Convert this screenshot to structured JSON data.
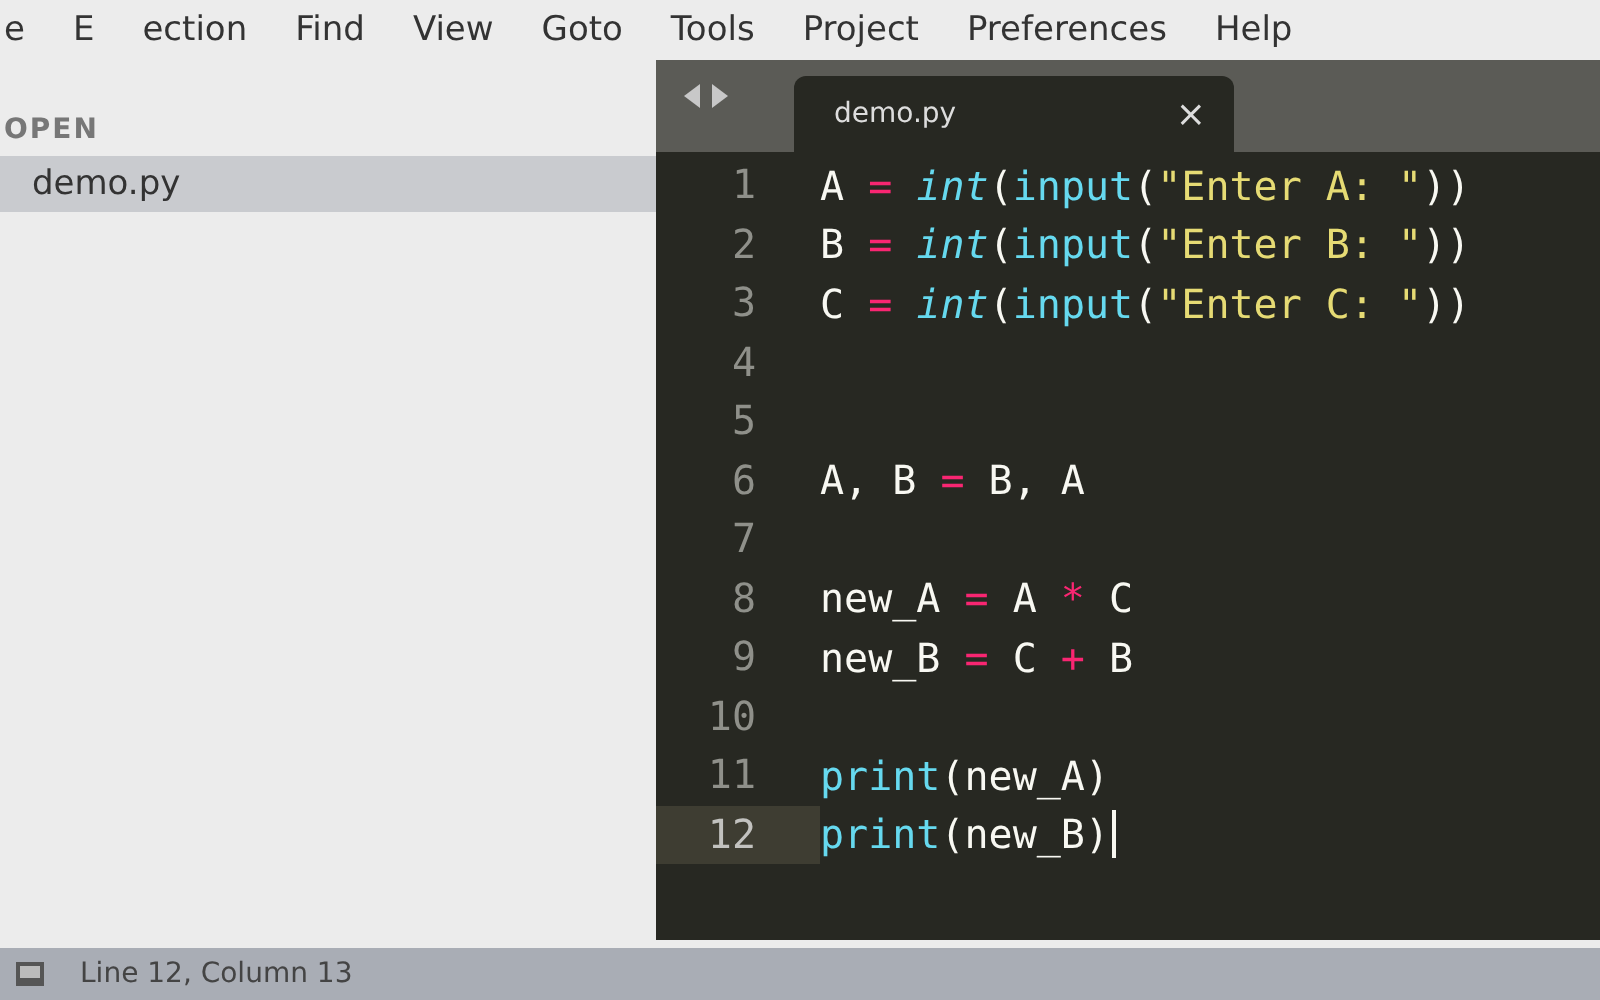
{
  "menu": [
    "e",
    "E",
    "ection",
    "Find",
    "View",
    "Goto",
    "Tools",
    "Project",
    "Preferences",
    "Help"
  ],
  "sidebar": {
    "header": "OPEN",
    "items": [
      {
        "label": "demo.py",
        "selected": true
      }
    ]
  },
  "tabs": [
    {
      "label": "demo.py",
      "selected": true,
      "close": "×"
    }
  ],
  "editor": {
    "lines": [
      {
        "number": "1",
        "current": false,
        "tokens": [
          {
            "kind": "plain",
            "text": "A "
          },
          {
            "kind": "op",
            "text": "= "
          },
          {
            "kind": "type",
            "text": "int"
          },
          {
            "kind": "plain",
            "text": "("
          },
          {
            "kind": "func",
            "text": "input"
          },
          {
            "kind": "plain",
            "text": "("
          },
          {
            "kind": "string",
            "text": "\"Enter A: \""
          },
          {
            "kind": "plain",
            "text": "))"
          }
        ]
      },
      {
        "number": "2",
        "current": false,
        "tokens": [
          {
            "kind": "plain",
            "text": "B "
          },
          {
            "kind": "op",
            "text": "= "
          },
          {
            "kind": "type",
            "text": "int"
          },
          {
            "kind": "plain",
            "text": "("
          },
          {
            "kind": "func",
            "text": "input"
          },
          {
            "kind": "plain",
            "text": "("
          },
          {
            "kind": "string",
            "text": "\"Enter B: \""
          },
          {
            "kind": "plain",
            "text": "))"
          }
        ]
      },
      {
        "number": "3",
        "current": false,
        "tokens": [
          {
            "kind": "plain",
            "text": "C "
          },
          {
            "kind": "op",
            "text": "= "
          },
          {
            "kind": "type",
            "text": "int"
          },
          {
            "kind": "plain",
            "text": "("
          },
          {
            "kind": "func",
            "text": "input"
          },
          {
            "kind": "plain",
            "text": "("
          },
          {
            "kind": "string",
            "text": "\"Enter C: \""
          },
          {
            "kind": "plain",
            "text": "))"
          }
        ]
      },
      {
        "number": "4",
        "current": false
      },
      {
        "number": "5",
        "current": false
      },
      {
        "number": "6",
        "current": false,
        "tokens": [
          {
            "kind": "plain",
            "text": "A, B "
          },
          {
            "kind": "op",
            "text": "="
          },
          {
            "kind": "plain",
            "text": " B, A"
          }
        ]
      },
      {
        "number": "7",
        "current": false
      },
      {
        "number": "8",
        "current": false,
        "tokens": [
          {
            "kind": "plain",
            "text": "new_A "
          },
          {
            "kind": "op",
            "text": "="
          },
          {
            "kind": "plain",
            "text": " A "
          },
          {
            "kind": "op",
            "text": "*"
          },
          {
            "kind": "plain",
            "text": " C"
          }
        ]
      },
      {
        "number": "9",
        "current": false,
        "tokens": [
          {
            "kind": "plain",
            "text": "new_B "
          },
          {
            "kind": "op",
            "text": "="
          },
          {
            "kind": "plain",
            "text": " C "
          },
          {
            "kind": "op",
            "text": "+"
          },
          {
            "kind": "plain",
            "text": " B"
          }
        ]
      },
      {
        "number": "10",
        "current": false
      },
      {
        "number": "11",
        "current": false,
        "tokens": [
          {
            "kind": "func",
            "text": "print"
          },
          {
            "kind": "plain",
            "text": "(new_A)"
          }
        ]
      },
      {
        "number": "12",
        "current": true,
        "tokens": [
          {
            "kind": "func",
            "text": "print"
          },
          {
            "kind": "plain",
            "text": "(new_B)"
          }
        ]
      }
    ]
  },
  "status_bar": {
    "text": "Line 12, Column 13"
  }
}
